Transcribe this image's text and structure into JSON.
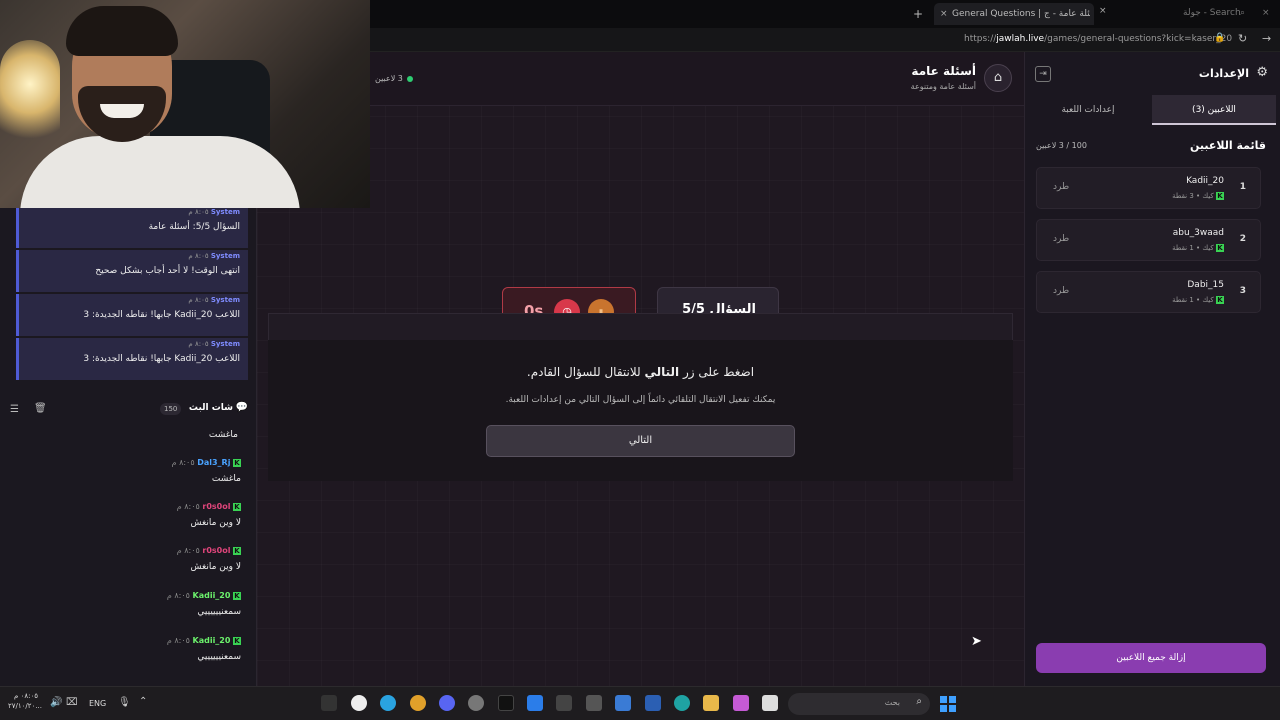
{
  "browser": {
    "tab_title": "General Questions | أسئلة عامة - ج...",
    "tab2_title": "جولة - Search",
    "url_prefix": "https://",
    "url_host": "jawlah.live",
    "url_path": "/games/general-questions?kick=kaser_20"
  },
  "left_chat": {
    "system_messages": [
      {
        "name": "System",
        "time": "٨:٠٥ م",
        "text": "السؤال 5/5: أسئلة عامة"
      },
      {
        "name": "System",
        "time": "٨:٠٥ م",
        "text": "انتهى الوقت! لا أحد أجاب بشكل صحيح"
      },
      {
        "name": "System",
        "time": "٨:٠٥ م",
        "text": "اللاعب Kadii_20 جابها! نقاطه الجديدة: 3"
      },
      {
        "name": "System",
        "time": "٨:٠٥ م",
        "text": "اللاعب Kadii_20 جابها! نقاطه الجديدة: 3"
      }
    ],
    "header_title": "شات البث",
    "header_count": "150",
    "first_text": "ماغشت",
    "messages": [
      {
        "user": "Dal3_Rj",
        "time": "٨:٠٥ م",
        "text": "ماغشت",
        "color": "#4aa3ff"
      },
      {
        "user": "r0s0ol",
        "time": "٨:٠٥ م",
        "text": "لا وين مانغش",
        "color": "#e0457b"
      },
      {
        "user": "r0s0ol",
        "time": "٨:٠٥ م",
        "text": "لا وين مانغش",
        "color": "#e0457b"
      },
      {
        "user": "Kadii_20",
        "time": "٨:٠٥ م",
        "text": "سمعنييييييي",
        "color": "#6cf26c"
      },
      {
        "user": "Kadii_20",
        "time": "٨:٠٥ م",
        "text": "سمعنييييييي",
        "color": "#6cf26c"
      }
    ]
  },
  "main": {
    "title": "أسئلة عامة",
    "subtitle": "أسئلة عامة ومتنوعة",
    "players_online": "3 لاعبين",
    "timer": "0s",
    "question_label": "السؤال 5/5",
    "prompt_prefix": "اضغط على زر",
    "prompt_bold": "التالي",
    "prompt_suffix": "للانتقال للسؤال القادم.",
    "hint": "يمكنك تفعيل الانتقال التلقائي دائماً إلى السؤال التالي من إعدادات اللعبة.",
    "next_button": "التالي"
  },
  "settings": {
    "title": "الإعدادات",
    "tabs": [
      {
        "label": "اللاعبين (3)",
        "active": true
      },
      {
        "label": "إعدادات اللعبة",
        "active": false
      }
    ],
    "players_title": "قائمة اللاعبين",
    "players_count": "100 / 3 لاعبين",
    "kick_label": "طرد",
    "players": [
      {
        "rank": "1",
        "name": "Kadii_20",
        "platform": "كيك",
        "points": "3 نقطة"
      },
      {
        "rank": "2",
        "name": "abu_3waad",
        "platform": "كيك",
        "points": "1 نقطة"
      },
      {
        "rank": "3",
        "name": "Dabi_15",
        "platform": "كيك",
        "points": "1 نقطة"
      }
    ],
    "remove_all": "إزالة جميع اللاعبين"
  },
  "taskbar": {
    "search_placeholder": "بحث",
    "lang": "ENG",
    "clock_time": "٠٨:٠٥ م",
    "clock_date": "٢٧/١٠/٢٠..."
  },
  "colors": {
    "accent_purple": "#8a3db0",
    "timer_red": "#b03a46",
    "system_blue": "#4f5bd5",
    "kick_green": "#39d353",
    "online_green": "#2ecc71"
  }
}
